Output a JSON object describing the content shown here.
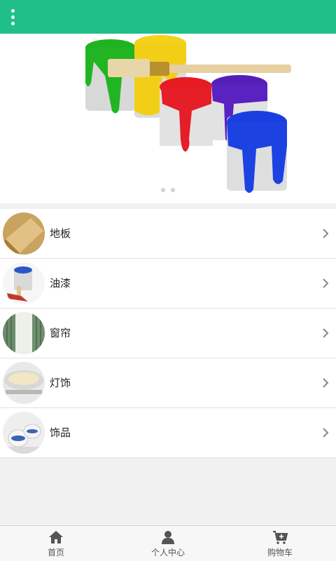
{
  "header": {
    "menu_icon": "more-vertical-icon",
    "accent_color": "#20bf8a"
  },
  "banner": {
    "image": "paint-cans-with-brush",
    "slide_count": 2
  },
  "categories": [
    {
      "label": "地板",
      "icon": "floor-thumbnail"
    },
    {
      "label": "油漆",
      "icon": "paint-thumbnail"
    },
    {
      "label": "窗帘",
      "icon": "curtain-thumbnail"
    },
    {
      "label": "灯饰",
      "icon": "lamp-thumbnail"
    },
    {
      "label": "饰品",
      "icon": "ornament-thumbnail"
    }
  ],
  "tabbar": [
    {
      "label": "首页",
      "icon": "home-icon"
    },
    {
      "label": "个人中心",
      "icon": "user-icon"
    },
    {
      "label": "购物车",
      "icon": "cart-icon"
    }
  ]
}
